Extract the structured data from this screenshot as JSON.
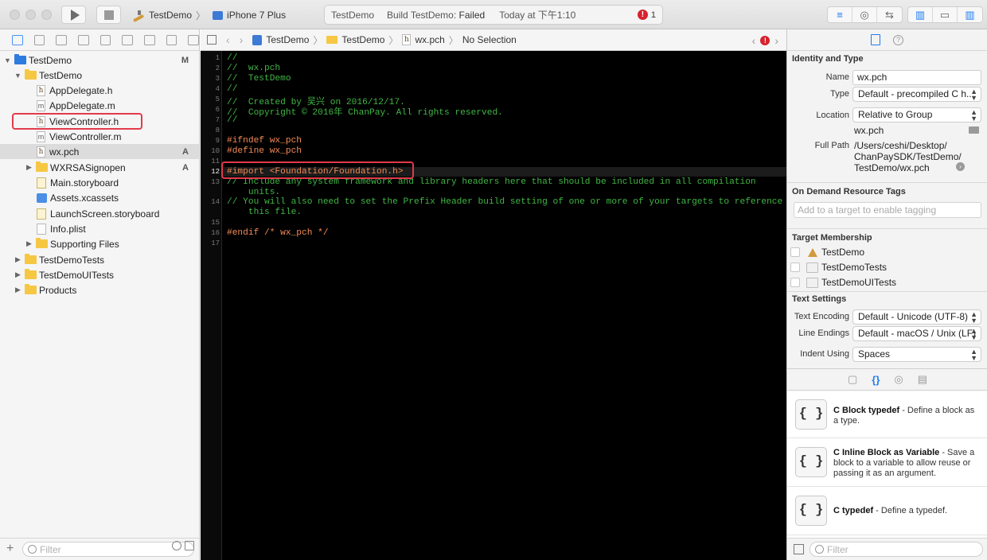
{
  "toolbar": {
    "scheme_name": "TestDemo",
    "scheme_separator": "〉",
    "device": "iPhone 7 Plus",
    "activity_project": "TestDemo",
    "activity_build_prefix": "Build TestDemo:",
    "activity_build_status": "Failed",
    "activity_time": "Today at 下午1:10",
    "error_count": "1",
    "error_glyph": "!"
  },
  "navigator": {
    "items": [
      {
        "label": "TestDemo",
        "badge": "M"
      },
      {
        "label": "TestDemo",
        "badge": ""
      },
      {
        "label": "AppDelegate.h",
        "badge": ""
      },
      {
        "label": "AppDelegate.m",
        "badge": ""
      },
      {
        "label": "ViewController.h",
        "badge": ""
      },
      {
        "label": "ViewController.m",
        "badge": ""
      },
      {
        "label": "wx.pch",
        "badge": "A"
      },
      {
        "label": "WXRSASignopen",
        "badge": "A"
      },
      {
        "label": "Main.storyboard",
        "badge": ""
      },
      {
        "label": "Assets.xcassets",
        "badge": ""
      },
      {
        "label": "LaunchScreen.storyboard",
        "badge": ""
      },
      {
        "label": "Info.plist",
        "badge": ""
      },
      {
        "label": "Supporting Files",
        "badge": ""
      },
      {
        "label": "TestDemoTests",
        "badge": ""
      },
      {
        "label": "TestDemoUITests",
        "badge": ""
      },
      {
        "label": "Products",
        "badge": ""
      }
    ],
    "file_icon_h": "h",
    "file_icon_m": "m",
    "filter_placeholder": "Filter",
    "add_glyph": "+"
  },
  "jumpbar": {
    "crumbs": [
      "TestDemo",
      "TestDemo",
      "wx.pch",
      "No Selection"
    ],
    "error_glyph": "!"
  },
  "editor": {
    "line_numbers": [
      "1",
      "2",
      "3",
      "4",
      "5",
      "6",
      "7",
      "8",
      "9",
      "10",
      "11",
      "12",
      "13",
      "",
      "14",
      "",
      "15",
      "16",
      "17"
    ],
    "current_line": "12",
    "lines": [
      {
        "kind": "comment",
        "text": "//"
      },
      {
        "kind": "comment",
        "text": "//  wx.pch"
      },
      {
        "kind": "comment",
        "text": "//  TestDemo"
      },
      {
        "kind": "comment",
        "text": "//"
      },
      {
        "kind": "comment",
        "text": "//  Created by 吴兴 on 2016/12/17."
      },
      {
        "kind": "comment",
        "text": "//  Copyright © 2016年 ChanPay. All rights reserved."
      },
      {
        "kind": "comment",
        "text": "//"
      },
      {
        "kind": "blank",
        "text": ""
      },
      {
        "kind": "preproc",
        "text": "#ifndef wx_pch"
      },
      {
        "kind": "preproc",
        "text": "#define wx_pch"
      },
      {
        "kind": "blank",
        "text": ""
      },
      {
        "kind": "preproc",
        "text": "#import <Foundation/Foundation.h>"
      },
      {
        "kind": "comment",
        "text": "// Include any system framework and library headers here that should be included in all compilation"
      },
      {
        "kind": "comment",
        "text": "    units."
      },
      {
        "kind": "comment",
        "text": "// You will also need to set the Prefix Header build setting of one or more of your targets to reference"
      },
      {
        "kind": "comment",
        "text": "    this file."
      },
      {
        "kind": "blank",
        "text": ""
      },
      {
        "kind": "preproc",
        "text": "#endif /* wx_pch */"
      },
      {
        "kind": "blank",
        "text": ""
      }
    ]
  },
  "inspector": {
    "identity_title": "Identity and Type",
    "name_label": "Name",
    "name_value": "wx.pch",
    "type_label": "Type",
    "type_value": "Default - precompiled C h...",
    "location_label": "Location",
    "location_value": "Relative to Group",
    "location_file": "wx.pch",
    "fullpath_label": "Full Path",
    "fullpath_lines": [
      "/Users/ceshi/Desktop/",
      "ChanPaySDK/TestDemo/",
      "TestDemo/wx.pch"
    ],
    "ondemand_title": "On Demand Resource Tags",
    "ondemand_placeholder": "Add to a target to enable tagging",
    "target_title": "Target Membership",
    "targets": [
      "TestDemo",
      "TestDemoTests",
      "TestDemoUITests"
    ],
    "text_settings_title": "Text Settings",
    "encoding_label": "Text Encoding",
    "encoding_value": "Default - Unicode (UTF-8)",
    "endings_label": "Line Endings",
    "endings_value": "Default - macOS / Unix (LF)",
    "indent_label": "Indent Using",
    "indent_value": "Spaces",
    "arrow_glyph": "›",
    "chevron_up": "▲",
    "chevron_down": "▼"
  },
  "library": {
    "tab_glyphs": [
      "▢",
      "{}",
      "◎",
      "▤"
    ],
    "icon_glyph": "{ }",
    "items": [
      {
        "title": "C Block typedef",
        "desc": " - Define a block as a type."
      },
      {
        "title": "C Inline Block as Variable",
        "desc": " - Save a block to a variable to allow reuse or passing it as an argument."
      },
      {
        "title": "C typedef",
        "desc": " - Define a typedef."
      }
    ],
    "filter_placeholder": "Filter"
  },
  "colors": {
    "accent": "#1d7cf2",
    "error_red": "#d6232f",
    "highlight_box": "#e23a4b",
    "comment_green": "#41b645",
    "preproc_orange": "#f58b55"
  }
}
